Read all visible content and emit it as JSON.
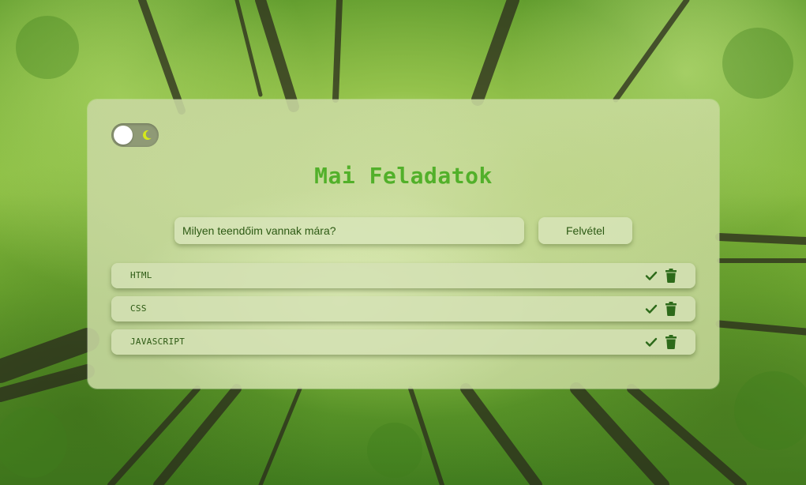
{
  "app": {
    "title": "Mai Feladatok"
  },
  "theme_toggle": {
    "icon": "moon-icon",
    "accent": "#d4e81c"
  },
  "new_task": {
    "placeholder": "Milyen teendőim vannak mára?",
    "value": "",
    "add_label": "Felvétel"
  },
  "tasks": [
    {
      "text": "HTML",
      "complete_icon": "check-icon",
      "delete_icon": "trash-icon"
    },
    {
      "text": "CSS",
      "complete_icon": "check-icon",
      "delete_icon": "trash-icon"
    },
    {
      "text": "JAVASCRIPT",
      "complete_icon": "check-icon",
      "delete_icon": "trash-icon"
    }
  ],
  "colors": {
    "title": "#52b02a",
    "text": "#2d5a14",
    "icon": "#2d6a1a"
  }
}
